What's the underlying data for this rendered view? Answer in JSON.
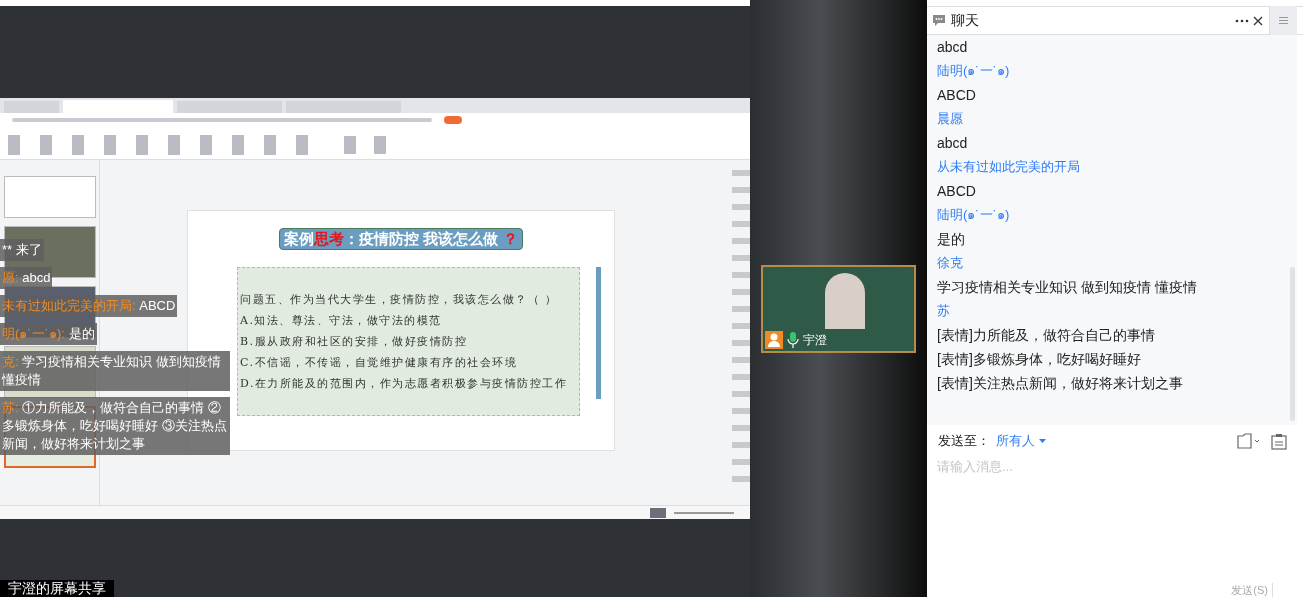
{
  "screen_share": {
    "app_tabs": [
      {
        "selected": false
      },
      {
        "selected": true
      },
      {
        "selected": false
      },
      {
        "selected": false
      }
    ],
    "slide": {
      "title": [
        {
          "text": "案例",
          "highlight": false
        },
        {
          "text": "思考",
          "highlight": true
        },
        {
          "text": "：疫情防控 我该怎么做 ",
          "highlight": false
        },
        {
          "text": "？",
          "highlight": true
        }
      ],
      "lines": [
        "问题五、作为当代大学生，疫情防控，我该怎么做？（ ）",
        "A.知法、尊法、守法，做守法的模范",
        "B.服从政府和社区的安排，做好疫情防控",
        "C.不信谣，不传谣，自觉维护健康有序的社会环境",
        "D.在力所能及的范围内，作为志愿者积极参与疫情防控工作"
      ]
    },
    "danmaku": [
      {
        "text": "** 来了"
      },
      {
        "name": "愿:",
        "text": "abcd"
      },
      {
        "name": "未有过如此完美的开局:",
        "text": "ABCD"
      },
      {
        "name": "明(๑˙一˙๑):",
        "text": "是的"
      },
      {
        "name": "克:",
        "text": "学习疫情相关专业知识 做到知疫情懂疫情"
      },
      {
        "name": "苏:",
        "text": "①力所能及，做符合自己的事情 ②多锻炼身体，吃好喝好睡好 ③关注热点新闻，做好将来计划之事"
      }
    ],
    "label": "宇澄的屏幕共享"
  },
  "video": {
    "name": "宇澄"
  },
  "chat": {
    "title": "聊天",
    "messages": [
      {
        "kind": "text",
        "text": "abcd"
      },
      {
        "kind": "sender",
        "text": "陆明(๑˙一˙๑)"
      },
      {
        "kind": "text",
        "text": "ABCD"
      },
      {
        "kind": "sender",
        "text": "晨愿"
      },
      {
        "kind": "text",
        "text": "abcd"
      },
      {
        "kind": "sender",
        "text": "从未有过如此完美的开局"
      },
      {
        "kind": "text",
        "text": "ABCD"
      },
      {
        "kind": "sender",
        "text": "陆明(๑˙一˙๑)"
      },
      {
        "kind": "text",
        "text": "是的"
      },
      {
        "kind": "sender",
        "text": "徐克"
      },
      {
        "kind": "text",
        "text": "学习疫情相关专业知识 做到知疫情 懂疫情"
      },
      {
        "kind": "sender",
        "text": "苏"
      },
      {
        "kind": "text",
        "text": "[表情]力所能及，做符合自己的事情"
      },
      {
        "kind": "text",
        "text": "[表情]多锻炼身体，吃好喝好睡好"
      },
      {
        "kind": "text",
        "text": "[表情]关注热点新闻，做好将来计划之事"
      }
    ],
    "send_to_label": "发送至：",
    "recipient": "所有人",
    "placeholder": "请输入消息...",
    "send_button": "发送(S)"
  }
}
